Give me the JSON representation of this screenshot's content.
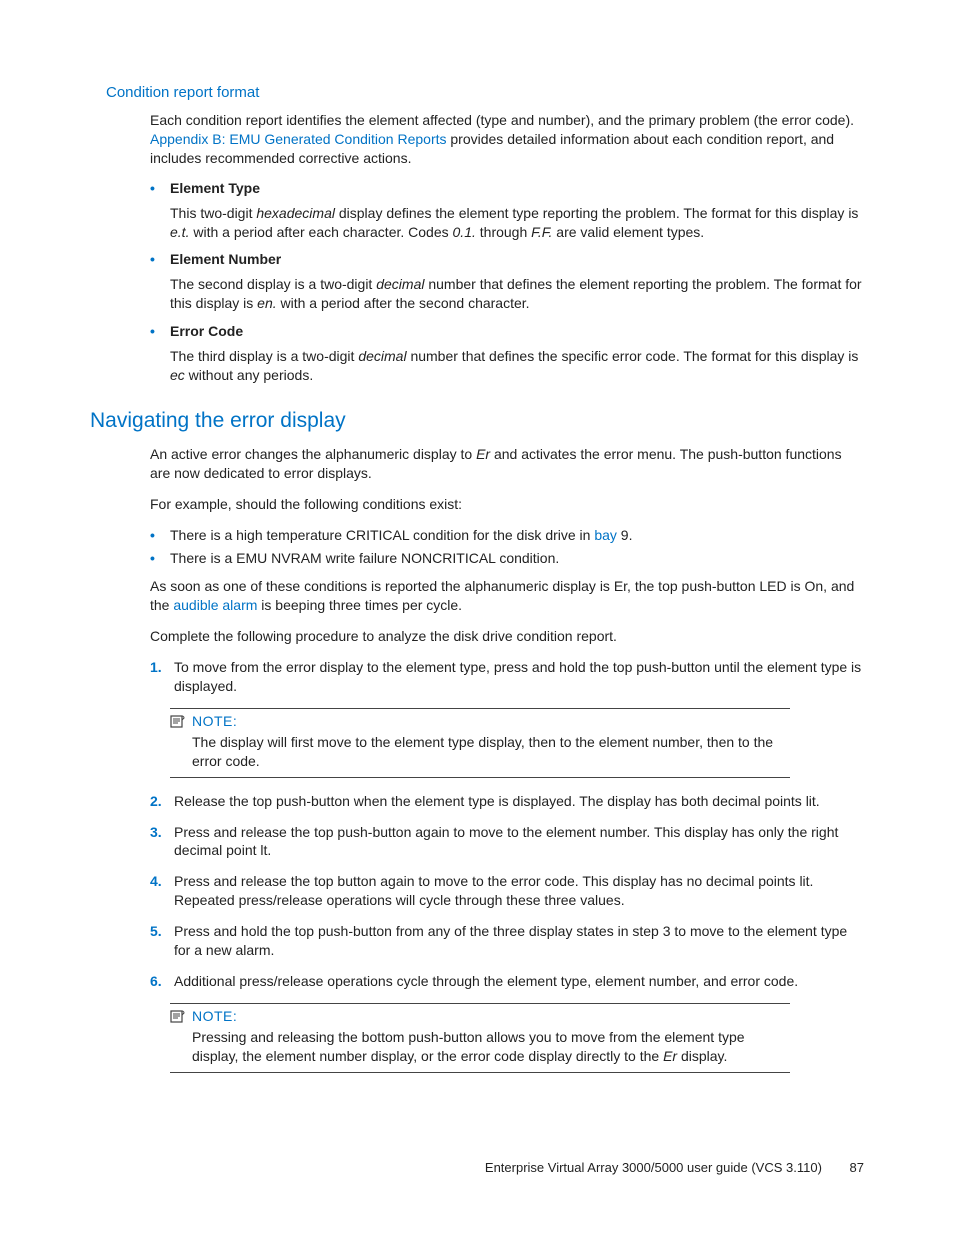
{
  "section1": {
    "heading": "Condition report format",
    "intro_parts": {
      "p1": "Each condition report identifies the element affected (type and number), and the primary problem (the error code). ",
      "link": "Appendix B: EMU Generated Condition Reports",
      "p2": " provides detailed information about each condition report, and includes recommended corrective actions."
    },
    "defs": [
      {
        "term": "Element Type",
        "desc_parts": {
          "a": "This two-digit ",
          "i1": "hexadecimal",
          "b": " display defines the element type reporting the problem. The format for this display is ",
          "i2": "e.t.",
          "c": " with a period after each character. Codes ",
          "i3": "0.1.",
          "d": " through ",
          "i4": "F.F.",
          "e": " are valid element types."
        }
      },
      {
        "term": "Element Number",
        "desc_parts": {
          "a": "The second display is a two-digit ",
          "i1": "decimal",
          "b": " number that defines the element reporting the problem. The format for this display is ",
          "i2": "en.",
          "c": " with a period after the second character."
        }
      },
      {
        "term": "Error Code",
        "desc_parts": {
          "a": "The third display is a two-digit ",
          "i1": "decimal",
          "b": " number that defines the specific error code. The format for this display is ",
          "i2": "ec",
          "c": " without any periods."
        }
      }
    ]
  },
  "section2": {
    "heading": "Navigating the error display",
    "p1_parts": {
      "a": "An active error changes the alphanumeric display to ",
      "i1": "Er",
      "b": " and activates the error menu. The push-button functions are now dedicated to error displays."
    },
    "p2": "For example, should the following conditions exist:",
    "bullets": [
      {
        "a": "There is a high temperature CRITICAL condition for the disk drive in ",
        "link": "bay",
        "b": " 9."
      },
      {
        "a": "There is a EMU NVRAM write failure NONCRITICAL condition."
      }
    ],
    "p3_parts": {
      "a": "As soon as one of these conditions is reported the alphanumeric display is Er, the top push-button LED is On, and the ",
      "link": "audible alarm",
      "b": " is beeping three times per cycle."
    },
    "p4": "Complete the following procedure to analyze the disk drive condition report.",
    "steps": [
      "To move from the error display to the element type, press and hold the top push-button until the element type is displayed.",
      "Release the top push-button when the element type is displayed. The display has both decimal points lit.",
      "Press and release the top push-button again to move to the element number. This display has only the right decimal point lt.",
      "Press and release the top button again to move to the error code. This display has no decimal points lit. Repeated press/release operations will cycle through these three values.",
      "Press and hold the top push-button from any of the three display states in step 3 to move to the element type for a new alarm.",
      "Additional press/release operations cycle through the element type, element number, and error code."
    ],
    "note1": {
      "label": "NOTE:",
      "body": "The display will first move to the element type display, then to the element number, then to the error code."
    },
    "note2": {
      "label": "NOTE:",
      "body_parts": {
        "a": "Pressing and releasing the bottom push-button allows you to move from the element type display, the element number display, or the error code display directly to the ",
        "i1": "Er",
        "b": " display."
      }
    }
  },
  "footer": {
    "title": "Enterprise Virtual Array 3000/5000 user guide (VCS 3.110)",
    "page": "87"
  }
}
